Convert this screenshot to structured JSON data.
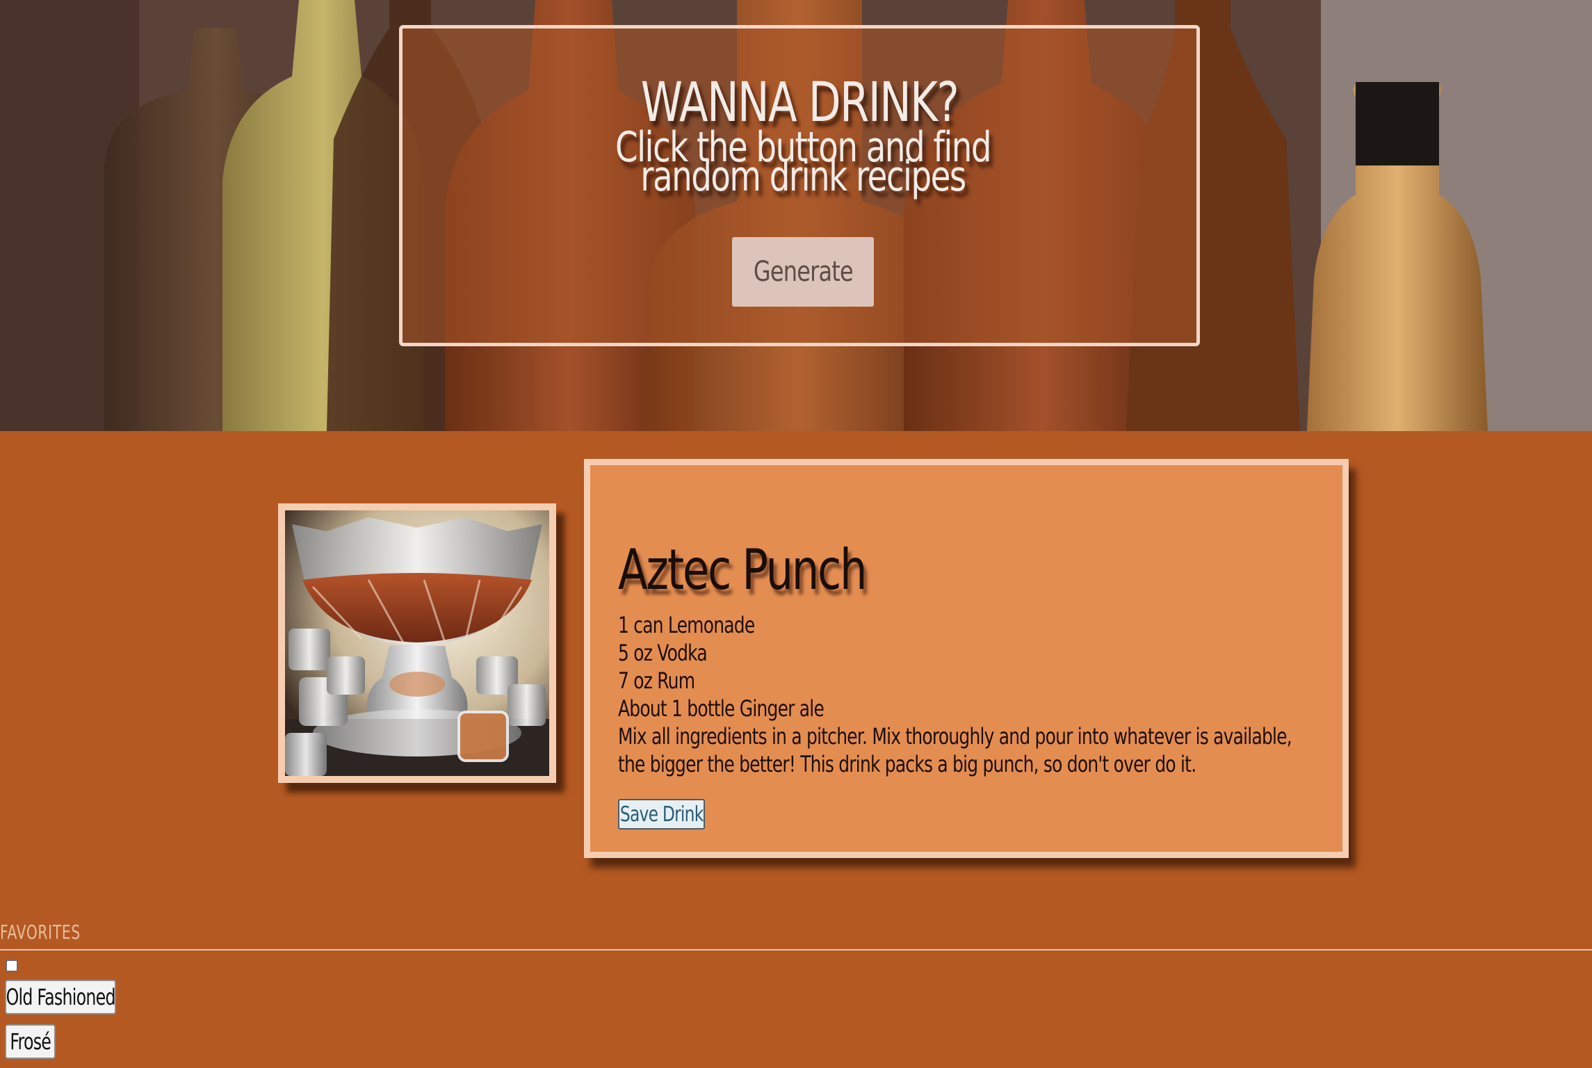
{
  "hero": {
    "title": "WANNA DRINK?",
    "subtitle": "Click the button and find random drink recipes",
    "generate_label": "Generate"
  },
  "drink": {
    "name": "Aztec Punch",
    "ingredients": [
      "1 can Lemonade",
      "5 oz Vodka",
      "7 oz Rum",
      "About 1 bottle Ginger ale"
    ],
    "instructions": "Mix all ingredients in a pitcher. Mix thoroughly and pour into whatever is available, the bigger the better! This drink packs a big punch, so don't over do it.",
    "save_label": "Save Drink"
  },
  "favorites": {
    "legend": "FAVORITES",
    "items": [
      "Old Fashioned",
      "Frosé"
    ]
  },
  "colors": {
    "page_background": "#b55922",
    "card_background": "#e48d51",
    "card_border": "#f6cdb1"
  }
}
